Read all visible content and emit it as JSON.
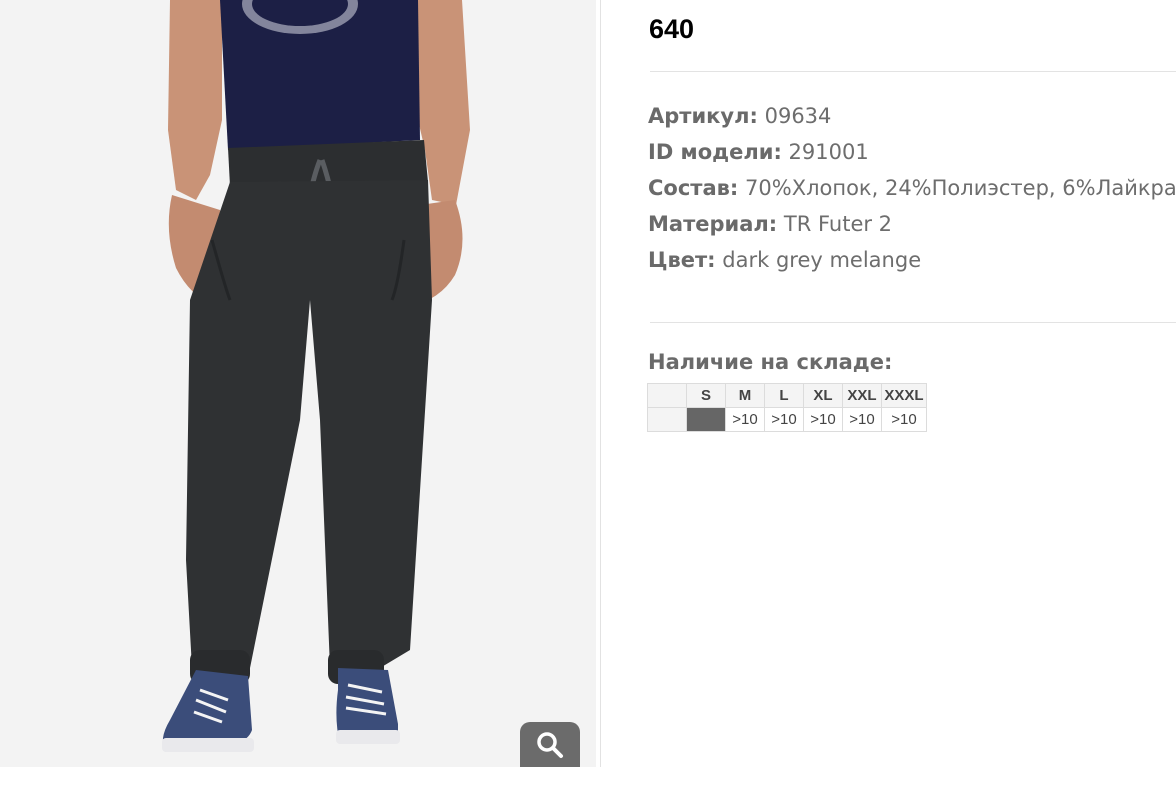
{
  "product": {
    "price": "640",
    "specs": [
      {
        "label": "Артикул:",
        "value": "09634"
      },
      {
        "label": "ID модели:",
        "value": "291001"
      },
      {
        "label": "Состав:",
        "value": "70%Хлопок, 24%Полиэстер, 6%Лайкра"
      },
      {
        "label": "Материал:",
        "value": "TR Futer 2"
      },
      {
        "label": "Цвет:",
        "value": "dark grey melange"
      }
    ],
    "color_swatch": "#2b2d2e"
  },
  "stock": {
    "title": "Наличие на складе:",
    "sizes": [
      "S",
      "M",
      "L",
      "XL",
      "XXL",
      "XXXL"
    ],
    "quantities": [
      "",
      ">10",
      ">10",
      ">10",
      ">10",
      ">10"
    ],
    "out_of_stock_color": "#666666"
  },
  "image": {
    "zoom_icon": "magnifier-icon"
  }
}
